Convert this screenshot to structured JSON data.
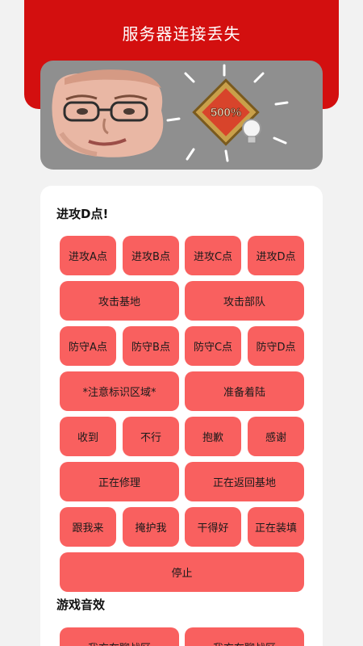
{
  "header": {
    "title": "服务器连接丢失"
  },
  "banner": {
    "badge_text": "500%"
  },
  "section1": {
    "title": "进攻D点!",
    "buttons": {
      "attack_a": "进攻A点",
      "attack_b": "进攻B点",
      "attack_c": "进攻C点",
      "attack_d": "进攻D点",
      "attack_base": "攻击基地",
      "attack_troops": "攻击部队",
      "defend_a": "防守A点",
      "defend_b": "防守B点",
      "defend_c": "防守C点",
      "defend_d": "防守D点",
      "mark_area": "*注意标识区域*",
      "prepare_landing": "准备着陆",
      "roger": "收到",
      "negative": "不行",
      "sorry": "抱歉",
      "thanks": "感谢",
      "repairing": "正在修理",
      "returning_base": "正在返回基地",
      "follow_me": "跟我来",
      "cover_me": "掩护我",
      "well_done": "干得好",
      "reloading": "正在装填",
      "stop": "停止"
    }
  },
  "section2": {
    "title": "游戏音效",
    "buttons": {
      "sound_1": "我方在聊战区",
      "sound_2": "我方在聊战区"
    }
  },
  "colors": {
    "header": "#d30f0f",
    "button": "#f9605f",
    "background": "#f2f2f2",
    "banner": "#8f8f8f"
  }
}
